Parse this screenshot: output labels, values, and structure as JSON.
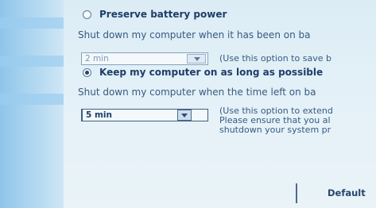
{
  "options": {
    "preserve": {
      "label": "Preserve battery power",
      "selected": false,
      "description": "Shut down my computer when it has been on ba",
      "select_value": "2 min",
      "note": "(Use this option to save b"
    },
    "keep_on": {
      "label": "Keep my computer on as long as possible",
      "selected": true,
      "description": "Shut down my computer when the time left on ba",
      "select_value": "5 min",
      "note_lines": [
        "(Use this option to extend",
        "Please ensure that you al",
        "shutdown your system pr"
      ]
    }
  },
  "default_button": {
    "label": "Default"
  },
  "icons": {
    "dropdown": "chevron-down-icon",
    "radio": "radio-button"
  }
}
